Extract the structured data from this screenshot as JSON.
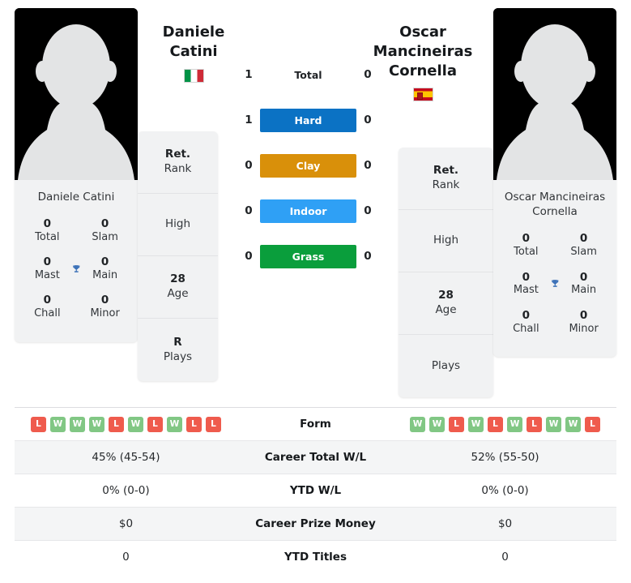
{
  "players": {
    "left": {
      "name_lines": [
        "Daniele",
        "Catini"
      ],
      "full_name": "Daniele Catini",
      "flag": "it",
      "flag_name": "italy-flag",
      "avatar": "player-avatar-placeholder",
      "trophies": [
        {
          "value": "0",
          "label": "Total"
        },
        {
          "value": "0",
          "label": "Slam"
        },
        {
          "value": "0",
          "label": "Mast"
        },
        {
          "value": "0",
          "label": "Main"
        },
        {
          "value": "0",
          "label": "Chall"
        },
        {
          "value": "0",
          "label": "Minor"
        }
      ],
      "info": [
        {
          "value": "Ret.",
          "label": "Rank"
        },
        {
          "value": "",
          "label": "High"
        },
        {
          "value": "28",
          "label": "Age"
        },
        {
          "value": "R",
          "label": "Plays"
        }
      ],
      "form": [
        "L",
        "W",
        "W",
        "W",
        "L",
        "W",
        "L",
        "W",
        "L",
        "L"
      ],
      "career_total_wl": "45% (45-54)",
      "ytd_wl": "0% (0-0)",
      "career_prize_money": "$0",
      "ytd_titles": "0"
    },
    "right": {
      "name_lines": [
        "Oscar",
        "Mancineiras",
        "Cornella"
      ],
      "full_name": "Oscar Mancineiras Cornella",
      "flag": "es",
      "flag_name": "spain-flag",
      "avatar": "player-avatar-placeholder",
      "trophies": [
        {
          "value": "0",
          "label": "Total"
        },
        {
          "value": "0",
          "label": "Slam"
        },
        {
          "value": "0",
          "label": "Mast"
        },
        {
          "value": "0",
          "label": "Main"
        },
        {
          "value": "0",
          "label": "Chall"
        },
        {
          "value": "0",
          "label": "Minor"
        }
      ],
      "info": [
        {
          "value": "Ret.",
          "label": "Rank"
        },
        {
          "value": "",
          "label": "High"
        },
        {
          "value": "28",
          "label": "Age"
        },
        {
          "value": "",
          "label": "Plays"
        }
      ],
      "form": [
        "W",
        "W",
        "L",
        "W",
        "L",
        "W",
        "L",
        "W",
        "W",
        "L"
      ],
      "career_total_wl": "52% (55-50)",
      "ytd_wl": "0% (0-0)",
      "career_prize_money": "$0",
      "ytd_titles": "0"
    }
  },
  "head_to_head": {
    "rows": [
      {
        "label": "Total",
        "left": "1",
        "right": "0",
        "style": "plain",
        "color": ""
      },
      {
        "label": "Hard",
        "left": "1",
        "right": "0",
        "style": "bar",
        "color": "#0b72c4"
      },
      {
        "label": "Clay",
        "left": "0",
        "right": "0",
        "style": "bar",
        "color": "#d9900a"
      },
      {
        "label": "Indoor",
        "left": "0",
        "right": "0",
        "style": "bar",
        "color": "#2fa0f5"
      },
      {
        "label": "Grass",
        "left": "0",
        "right": "0",
        "style": "bar",
        "color": "#0a9e3c"
      }
    ]
  },
  "comparison_table": {
    "rows": [
      {
        "label": "Form",
        "type": "form"
      },
      {
        "label": "Career Total W/L",
        "type": "text",
        "key": "career_total_wl"
      },
      {
        "label": "YTD W/L",
        "type": "text",
        "key": "ytd_wl"
      },
      {
        "label": "Career Prize Money",
        "type": "text",
        "key": "career_prize_money"
      },
      {
        "label": "YTD Titles",
        "type": "text",
        "key": "ytd_titles"
      }
    ]
  },
  "colors": {
    "win_badge": "#81c784",
    "loss_badge": "#ef5b4d",
    "card_bg": "#f1f2f3",
    "row_shade": "#f4f5f6"
  }
}
